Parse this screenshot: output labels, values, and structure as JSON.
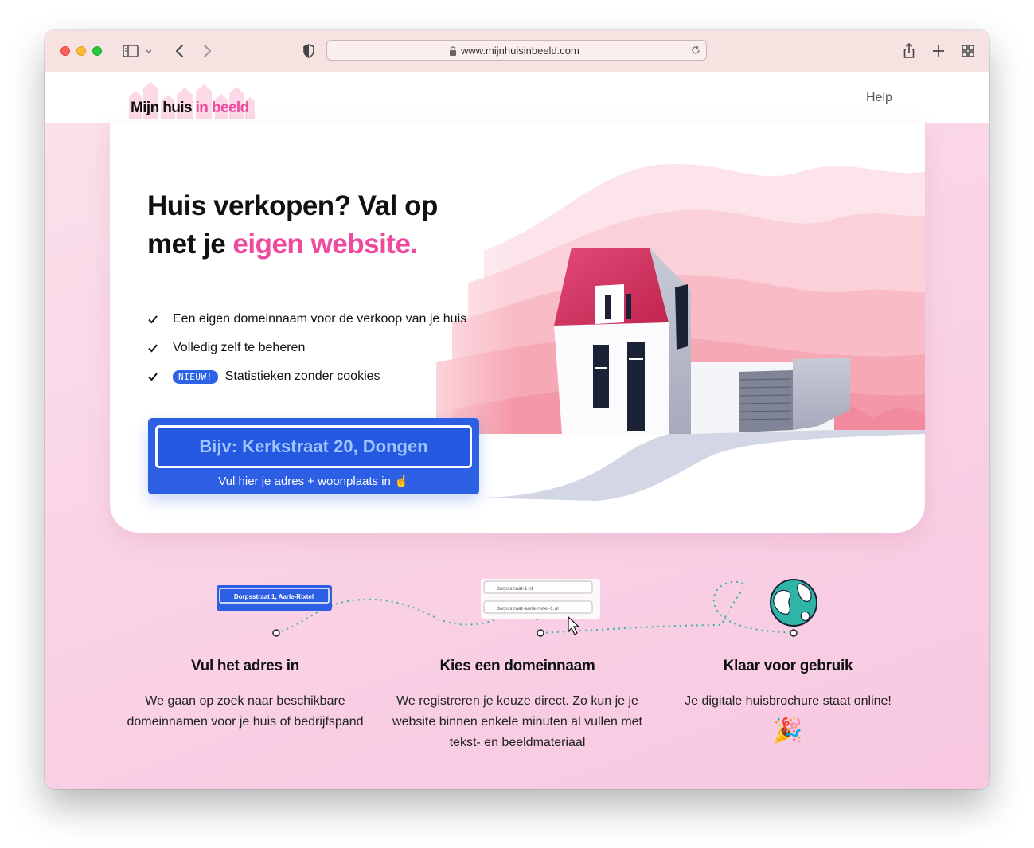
{
  "browser": {
    "url": "www.mijnhuisinbeeld.com"
  },
  "site": {
    "logo": {
      "main": "Mijn huis ",
      "accent": "in beeld"
    },
    "nav": {
      "help": "Help"
    }
  },
  "hero": {
    "title_line1": "Huis verkopen? Val op",
    "title_line2_prefix": "met je ",
    "title_line2_accent": "eigen website.",
    "features": [
      {
        "text": "Een eigen domeinnaam voor de verkoop van je huis"
      },
      {
        "text": "Volledig zelf te beheren"
      },
      {
        "badge": "NIEUW!",
        "text": "Statistieken zonder cookies"
      }
    ],
    "address": {
      "placeholder": "Bijv: Kerkstraat 20, Dongen",
      "hint": "Vul hier je adres + woonplaats in ☝️"
    }
  },
  "illustrations": {
    "search_sign": "Dorpsstraat 1, Aarle-Rixtel",
    "domain_options": [
      "dorpsstraat-1.nl",
      "dorpsstraat-aarle-rixtel-1.nl"
    ]
  },
  "steps": [
    {
      "title": "Vul het adres in",
      "text": "We gaan op zoek naar beschikbare domeinnamen voor je huis of bedrijfspand"
    },
    {
      "title": "Kies een domeinnaam",
      "text": "We registreren je keuze direct. Zo kun je je website binnen enkele minuten al vullen met tekst- en beeldmateriaal"
    },
    {
      "title": "Klaar voor gebruik",
      "text": "Je digitale huisbrochure staat online!",
      "emoji": "🎉"
    }
  ],
  "colors": {
    "accent_pink": "#ee4a9f",
    "primary_blue": "#2c5fe3",
    "teal_path": "#3ab5a5"
  }
}
